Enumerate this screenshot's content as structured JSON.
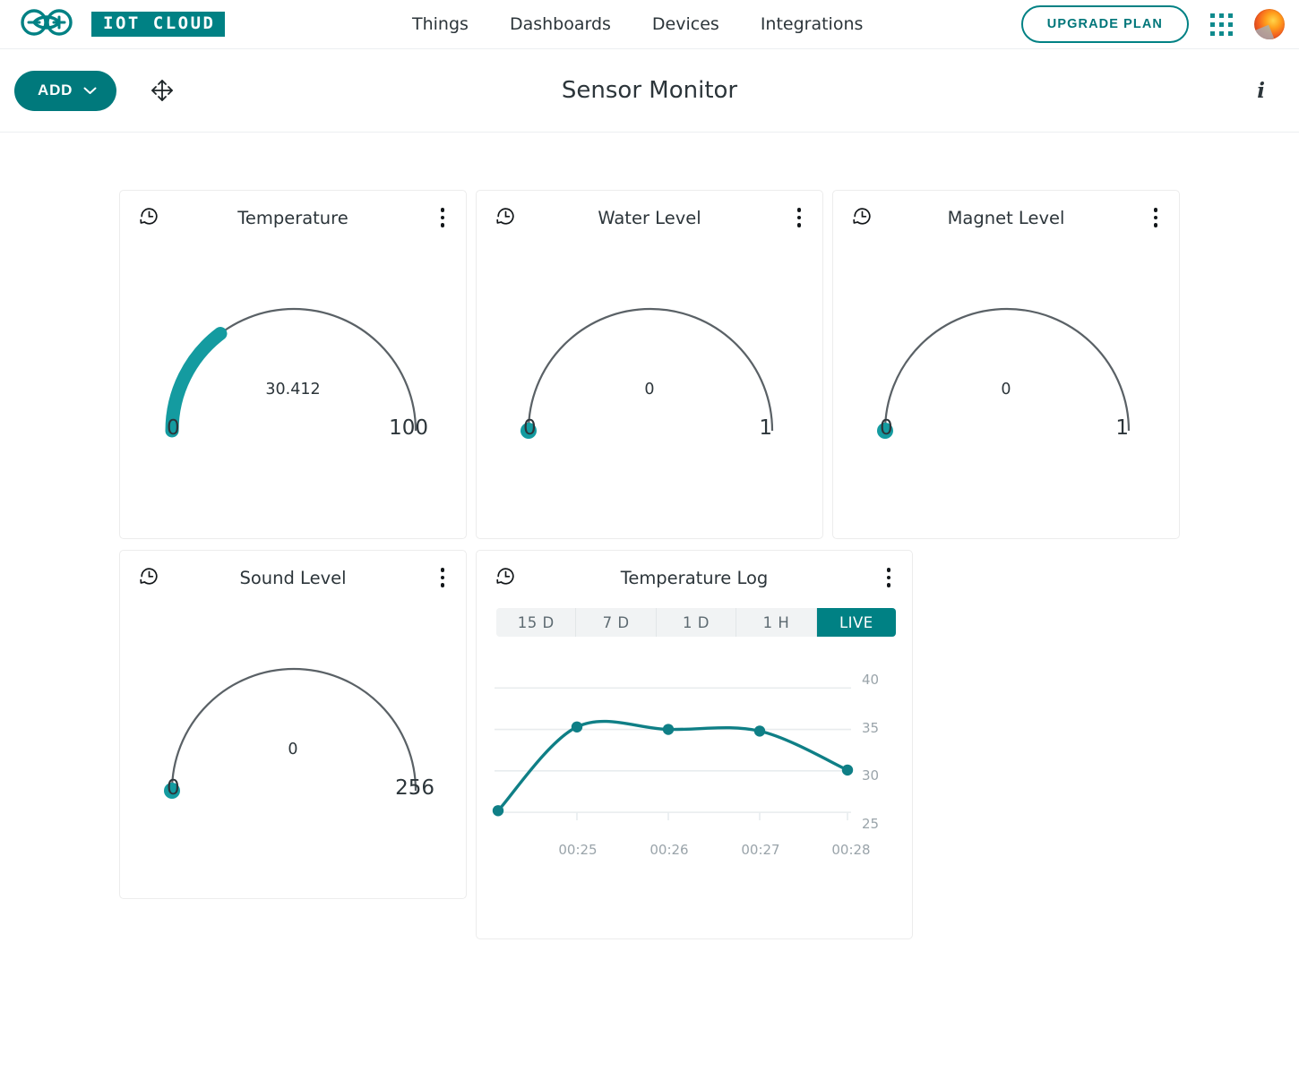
{
  "brand": {
    "name": "IOT CLOUD",
    "logo_icon": "arduino-infinity-logo"
  },
  "nav": {
    "links": [
      {
        "label": "Things"
      },
      {
        "label": "Dashboards"
      },
      {
        "label": "Devices"
      },
      {
        "label": "Integrations"
      }
    ],
    "upgrade_label": "UPGRADE PLAN",
    "apps_icon": "apps-grid-icon",
    "avatar_icon": "user-avatar"
  },
  "toolbar": {
    "add_label": "ADD",
    "add_chevron_icon": "chevron-down-icon",
    "move_icon": "move-arrows-icon",
    "title": "Sensor Monitor",
    "info_icon": "info-icon"
  },
  "colors": {
    "accent": "#008184",
    "gauge_fill": "#149ba0",
    "gauge_track": "#5a6166",
    "chart_line": "#0f7f86",
    "grid": "#e8ecee",
    "axis_text": "#9aa4aa"
  },
  "widgets": [
    {
      "title": "Temperature",
      "history_icon": "history-clock-icon",
      "menu_icon": "kebab-menu-icon",
      "type": "gauge",
      "value": "30.412",
      "min": "0",
      "max": "100",
      "percent": 30.412
    },
    {
      "title": "Water Level",
      "history_icon": "history-clock-icon",
      "menu_icon": "kebab-menu-icon",
      "type": "gauge",
      "value": "0",
      "min": "0",
      "max": "1",
      "percent": 0
    },
    {
      "title": "Magnet Level",
      "history_icon": "history-clock-icon",
      "menu_icon": "kebab-menu-icon",
      "type": "gauge",
      "value": "0",
      "min": "0",
      "max": "1",
      "percent": 0
    },
    {
      "title": "Sound Level",
      "history_icon": "history-clock-icon",
      "menu_icon": "kebab-menu-icon",
      "type": "gauge",
      "value": "0",
      "min": "0",
      "max": "256",
      "percent": 0
    },
    {
      "title": "Temperature Log",
      "history_icon": "history-clock-icon",
      "menu_icon": "kebab-menu-icon",
      "type": "chart",
      "ranges": [
        {
          "label": "15 D",
          "active": false
        },
        {
          "label": "7 D",
          "active": false
        },
        {
          "label": "1 D",
          "active": false
        },
        {
          "label": "1 H",
          "active": false
        },
        {
          "label": "LIVE",
          "active": true
        }
      ]
    }
  ],
  "chart_data": {
    "type": "line",
    "title": "Temperature Log",
    "xlabel": "",
    "ylabel": "",
    "x": [
      "00:24:40",
      "00:25:02",
      "00:26:03",
      "00:27:05",
      "00:28:05"
    ],
    "tick_labels_x": [
      "00:25",
      "00:26",
      "00:27",
      "00:28"
    ],
    "tick_values_y": [
      25,
      30,
      35,
      40
    ],
    "values": [
      25.2,
      35.3,
      35.0,
      34.8,
      30.1
    ],
    "ylim": [
      23.5,
      41
    ],
    "grid": true,
    "legend": "none",
    "y_axis_position": "right",
    "marker": "circle",
    "interpolation": "smooth"
  }
}
